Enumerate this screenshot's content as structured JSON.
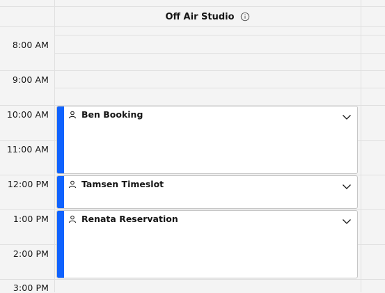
{
  "header": {
    "resource_name": "Off Air Studio"
  },
  "times": [
    "8:00 AM",
    "9:00 AM",
    "10:00 AM",
    "11:00 AM",
    "12:00 PM",
    "1:00 PM",
    "2:00 PM",
    "3:00 PM"
  ],
  "bookings": [
    {
      "title": "Ben Booking"
    },
    {
      "title": "Tamsen Timeslot"
    },
    {
      "title": "Renata Reservation"
    }
  ],
  "colors": {
    "accent": "#0f62fe",
    "background": "#f4f4f4",
    "card": "#ffffff",
    "gridline": "#e0e0e0"
  }
}
